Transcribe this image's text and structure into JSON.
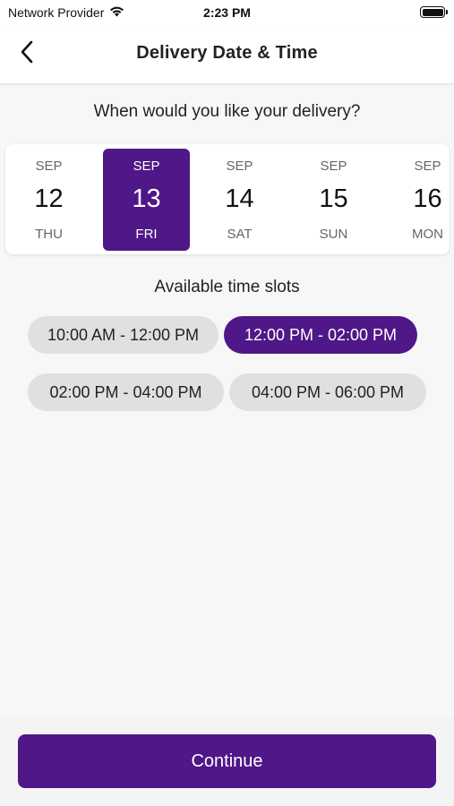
{
  "status_bar": {
    "carrier": "Network Provider",
    "time": "2:23 PM",
    "wifi_icon": "wifi-icon",
    "battery_icon": "battery-icon",
    "battery_level": 1.0
  },
  "nav": {
    "title": "Delivery Date & Time",
    "back_icon": "chevron-left-icon"
  },
  "question": "When would you like your delivery?",
  "dates": [
    {
      "month": "SEP",
      "day": "12",
      "weekday": "THU",
      "selected": false
    },
    {
      "month": "SEP",
      "day": "13",
      "weekday": "FRI",
      "selected": true
    },
    {
      "month": "SEP",
      "day": "14",
      "weekday": "SAT",
      "selected": false
    },
    {
      "month": "SEP",
      "day": "15",
      "weekday": "SUN",
      "selected": false
    },
    {
      "month": "SEP",
      "day": "16",
      "weekday": "MON",
      "selected": false
    }
  ],
  "slots_title": "Available time slots",
  "slots": [
    {
      "label": "10:00 AM - 12:00 PM",
      "selected": false
    },
    {
      "label": "12:00 PM - 02:00 PM",
      "selected": true
    },
    {
      "label": "02:00 PM - 04:00 PM",
      "selected": false
    },
    {
      "label": "04:00 PM - 06:00 PM",
      "selected": false
    }
  ],
  "footer": {
    "continue_label": "Continue"
  },
  "colors": {
    "accent": "#4f1787",
    "slot_unselected": "#e0e0e0",
    "background": "#f7f7f7"
  }
}
